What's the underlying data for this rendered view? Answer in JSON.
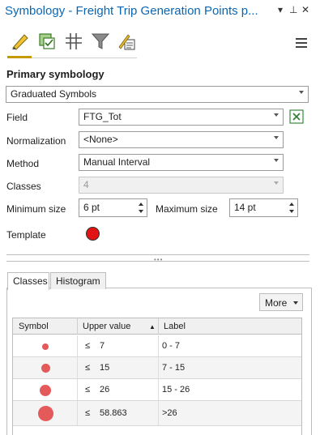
{
  "titlebar": {
    "title": "Symbology - Freight Trip Generation Points p...",
    "dropdown_glyph": "▾",
    "pin_glyph": "⊥",
    "close_glyph": "✕"
  },
  "toolbar": {
    "tools": [
      "primary-symbology-icon",
      "vary-symbology-icon",
      "symbol-layers-icon",
      "filter-icon",
      "advanced-symbology-icon"
    ],
    "menu_icon": "hamburger-menu-icon"
  },
  "primary_symbology": {
    "heading": "Primary symbology",
    "type": "Graduated Symbols"
  },
  "fields": {
    "field_label": "Field",
    "field_value": "FTG_Tot",
    "normalization_label": "Normalization",
    "normalization_value": "<None>",
    "method_label": "Method",
    "method_value": "Manual Interval",
    "classes_label": "Classes",
    "classes_value": "4",
    "min_size_label": "Minimum size",
    "min_size_value": "6 pt",
    "max_size_label": "Maximum size",
    "max_size_value": "14 pt",
    "template_label": "Template",
    "template_color": "#e21313"
  },
  "tabs": {
    "classes": "Classes",
    "histogram": "Histogram",
    "more": "More"
  },
  "table": {
    "headers": {
      "symbol": "Symbol",
      "upper": "Upper value",
      "label": "Label"
    },
    "sort_glyph": "▲",
    "rows": [
      {
        "op": "≤",
        "upper": "7",
        "label": "0 - 7"
      },
      {
        "op": "≤",
        "upper": "15",
        "label": "7 - 15"
      },
      {
        "op": "≤",
        "upper": "26",
        "label": "15 - 26"
      },
      {
        "op": "≤",
        "upper": "58.863",
        "label": ">26"
      }
    ],
    "symbol_color": "#e45a5a"
  }
}
